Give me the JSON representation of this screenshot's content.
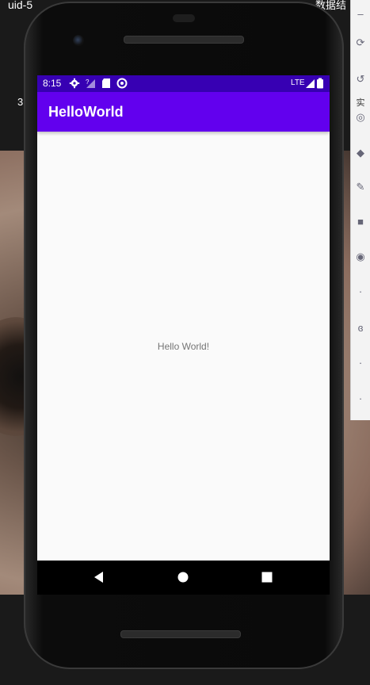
{
  "desktop": {
    "top_left_text": "uid-5",
    "top_right_text": "数据结",
    "side_text_a": "3",
    "side_text_b": "实"
  },
  "status_bar": {
    "time": "8:15",
    "network": "LTE",
    "color": "#3700b3"
  },
  "app_bar": {
    "title": "HelloWorld",
    "color": "#6200ee"
  },
  "content": {
    "message": "Hello World!"
  },
  "nav_bar": {
    "back_icon": "back-triangle-icon",
    "home_icon": "home-circle-icon",
    "recents_icon": "recents-square-icon"
  }
}
